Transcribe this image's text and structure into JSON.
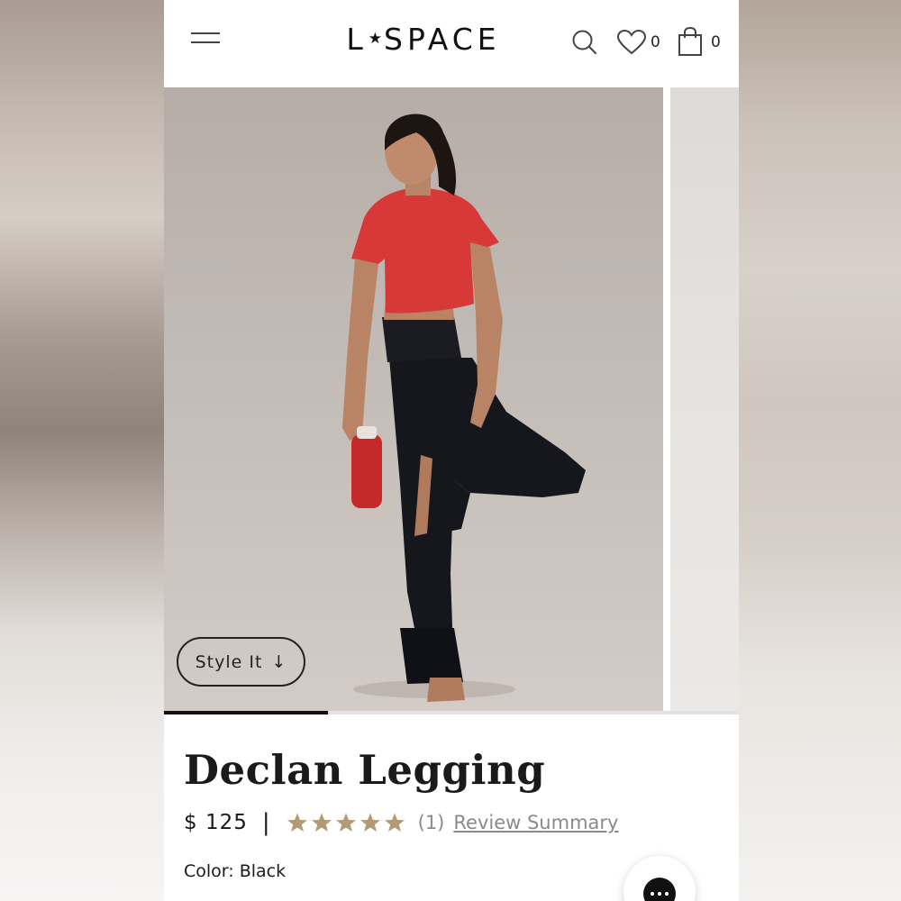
{
  "header": {
    "logo_text": "L★SPACE",
    "logo_left": "L",
    "logo_star": "★",
    "logo_right": "SPACE",
    "wishlist_count": "0",
    "cart_count": "0",
    "icons": [
      "menu-icon",
      "search-icon",
      "heart-icon",
      "shopping-bag-icon"
    ]
  },
  "gallery": {
    "style_it_label": "Style It",
    "style_it_arrow": "↓",
    "progress_fraction": 0.285
  },
  "product": {
    "title": "Declan Legging",
    "price": "$ 125",
    "separator": "|",
    "rating": 5,
    "rating_max": 5,
    "review_count": "(1)",
    "review_link": "Review Summary",
    "color_label": "Color: Black"
  },
  "colors": {
    "star": "#b39a77",
    "text": "#1a1a1a",
    "muted": "#8a8a8a"
  }
}
